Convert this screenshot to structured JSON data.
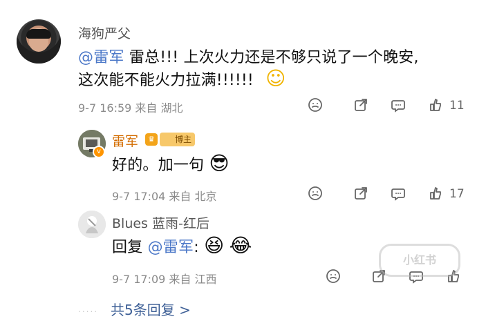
{
  "main_comment": {
    "username": "海狗严父",
    "mention": "@雷军",
    "text_line1": "雷总!!!  上次火力还是不够只说了一个晚安,",
    "text_line2": "这次能不能火力拉满!!!!!!",
    "emoji": "☺",
    "meta": "9-7 16:59 来自 湖北",
    "like_count": "11"
  },
  "reply_1": {
    "username": "雷军",
    "badge": "博主",
    "text": "好的。加一句",
    "emoji": "😎",
    "meta": "9-7 17:04 来自 北京",
    "like_count": "17"
  },
  "reply_2": {
    "username": "Blues 蓝雨-红后",
    "reply_prefix": "回复",
    "mention": "@雷军",
    "colon": ":",
    "emoji_1": "😆",
    "emoji_2": "😂",
    "meta": "9-7 17:09 来自 江西"
  },
  "more_replies": "共5条回复 >",
  "watermark": "小红书",
  "icons": {
    "reaction": "face-icon",
    "share": "share-icon",
    "comment": "comment-icon",
    "like": "thumbs-up-icon"
  }
}
